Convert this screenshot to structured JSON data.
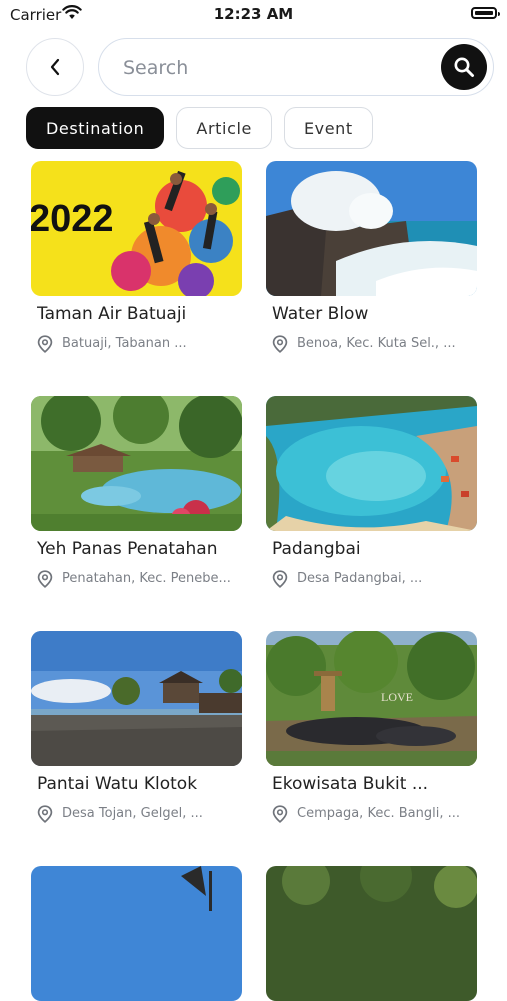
{
  "status_bar": {
    "carrier": "Carrier",
    "time": "12:23 AM"
  },
  "search": {
    "placeholder": "Search"
  },
  "tabs": [
    {
      "label": "Destination",
      "active": true
    },
    {
      "label": "Article",
      "active": false
    },
    {
      "label": "Event",
      "active": false
    }
  ],
  "destinations": [
    {
      "title": "Taman Air Batuaji",
      "location": "Batuaji, Tabanan ...",
      "image": "festival-poster",
      "image_text": "2022"
    },
    {
      "title": "Water Blow",
      "location": "Benoa, Kec. Kuta Sel., ...",
      "image": "waves-cliff"
    },
    {
      "title": "Yeh Panas Penatahan",
      "location": "Penatahan, Kec. Penebe...",
      "image": "pool-garden"
    },
    {
      "title": "Padangbai",
      "location": "Desa Padangbai, ...",
      "image": "bay-aerial"
    },
    {
      "title": "Pantai Watu Klotok",
      "location": "Desa Tojan, Gelgel, ...",
      "image": "beach-pavilion"
    },
    {
      "title": "Ekowisata Bukit ...",
      "location": "Cempaga, Kec. Bangli, ...",
      "image": "hill-crowd",
      "image_text": "LOVE"
    },
    {
      "title": "",
      "location": "",
      "image": "sky-partial"
    },
    {
      "title": "",
      "location": "",
      "image": "forest-partial"
    }
  ],
  "colors": {
    "accent": "#111111",
    "poster_yellow": "#f5e11b",
    "sea": "#2aa6c8"
  },
  "icons": {
    "back": "chevron-left-icon",
    "search": "search-icon",
    "location": "map-pin-icon",
    "wifi": "wifi-icon",
    "battery": "battery-icon"
  }
}
